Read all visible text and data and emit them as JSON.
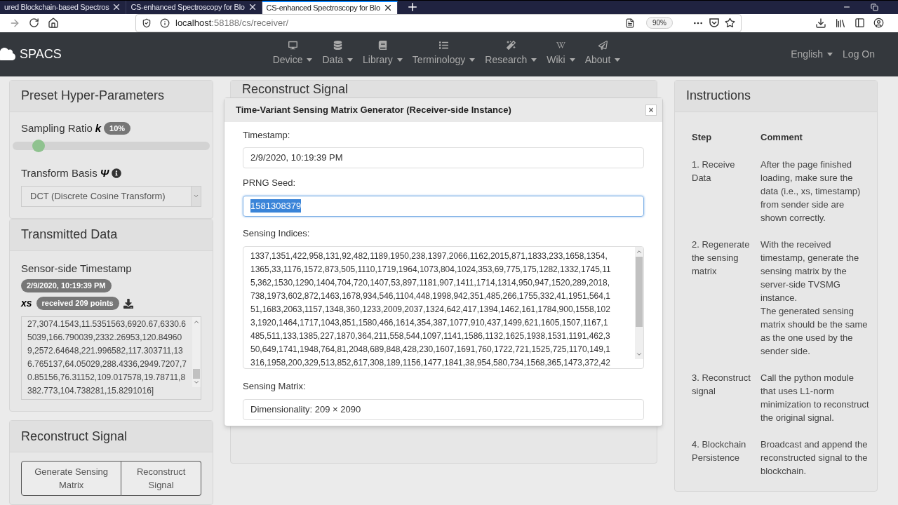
{
  "browser": {
    "tabs": [
      {
        "title": "ured Blockchain-based Spectros",
        "selected": false
      },
      {
        "title": "CS-enhanced Spectroscopy for Blo",
        "selected": false
      },
      {
        "title": "CS-enhanced Spectroscopy for Blo",
        "selected": true
      }
    ],
    "url": {
      "host": "localhost",
      "rest": ":58188/cs/receiver/"
    },
    "zoom": "90%"
  },
  "navbar": {
    "brand": "SPACS",
    "menus": [
      {
        "label": "Device",
        "kind": "desktop"
      },
      {
        "label": "Data",
        "kind": "database"
      },
      {
        "label": "Library",
        "kind": "book"
      },
      {
        "label": "Terminology",
        "kind": "list"
      },
      {
        "label": "Research",
        "kind": "wand"
      },
      {
        "label": "Wiki",
        "kind": "wiki"
      },
      {
        "label": "About",
        "kind": "plane"
      }
    ],
    "language": "English",
    "login": "Log On"
  },
  "preset": {
    "title": "Preset Hyper-Parameters",
    "sampling_label": "Sampling Ratio",
    "sampling_symbol": "k",
    "sampling_badge": "10%",
    "slider": {
      "level": 0.1
    },
    "basis_label": "Transform Basis",
    "basis_symbol": "Ψ",
    "basis_value": "DCT (Discrete Cosine Transform)"
  },
  "transmitted": {
    "title": "Transmitted Data",
    "timestamp_label": "Sensor-side Timestamp",
    "timestamp_badge": "2/9/2020, 10:19:39 PM",
    "xs_label": "xs",
    "xs_badge": "received 209 points",
    "xs_lines": [
      "27,3074.1543,11.5351563,6920.67,6330.6",
      "5039,166.790039,2332.26953,120.84960",
      "9,2572.64648,221.996582,117.303711,13",
      "6.765137,64.05029,288.4336,2949.7207,7",
      "0.85156,76.31152,109.017578,19.78711,8",
      "382.773,104.738281,15.8291016]"
    ]
  },
  "reconstruct": {
    "title": "Reconstruct Signal",
    "buttons": [
      "Generate Sensing Matrix",
      "Reconstruct Signal"
    ]
  },
  "middle_card": {
    "title": "Reconstruct Signal"
  },
  "modal": {
    "title": "Time-Variant Sensing Matrix Generator (Receiver-side Instance)",
    "close": "×",
    "timestamp_label": "Timestamp:",
    "timestamp_value": "2/9/2020, 10:19:39 PM",
    "seed_label": "PRNG Seed:",
    "seed_value": "1581308379",
    "indices_label": "Sensing Indices:",
    "indices_lines": [
      "1337,1351,422,958,131,92,482,1189,1950,238,1397,2066,1162,2015,871,1833,233,1658,1354,",
      "1365,33,1176,1572,873,505,1110,1719,1964,1073,804,1024,353,69,775,175,1282,1332,1745,11",
      "5,362,1530,1290,1404,704,720,1407,53,897,1181,907,1411,1714,1314,950,947,1520,289,2018,",
      "738,1973,602,872,1463,1678,934,546,1104,448,1998,942,351,485,266,1755,332,41,1951,564,1",
      "51,1683,2063,1157,1348,360,1233,2009,2037,1324,642,417,1394,1462,161,1784,900,1558,102",
      "3,1920,1464,1717,1043,851,1580,466,1614,354,387,1077,910,437,1499,621,1605,1507,1167,1",
      "485,511,133,1385,227,1870,364,211,558,544,1097,1141,1586,1132,1625,1938,1531,1191,462,3",
      "50,649,1741,1948,764,81,2048,689,848,428,230,1607,1691,760,1722,721,1525,725,1170,149,1",
      "316,1958,200,329,513,852,617,308,189,1156,1477,1841,38,954,580,734,1568,365,1473,372,42"
    ],
    "matrix_label": "Sensing Matrix:",
    "matrix_value": "Dimensionality: 209 × 2090"
  },
  "instructions": {
    "title": "Instructions",
    "columns": [
      "Step",
      "Comment"
    ],
    "rows": [
      {
        "step": "1. Receive Data",
        "comment": [
          "After the page finished loading, make sure the data (i.e., xs, timestamp) from sender side are shown correctly."
        ]
      },
      {
        "step": "2. Regenerate the sensing matrix",
        "comment": [
          "With the received timestamp, generate the sensing matrix by the server-side TVSMG instance.",
          "The generated sensing matrix should be the same as the one used by the sender side."
        ]
      },
      {
        "step": "3. Reconstruct signal",
        "comment": [
          "Call the python module that uses L1-norm minimization to reconstruct the original signal."
        ]
      },
      {
        "step": "4. Blockchain Persistence",
        "comment": [
          "Broadcast and append the reconstructed signal to the blockchain."
        ]
      }
    ]
  }
}
